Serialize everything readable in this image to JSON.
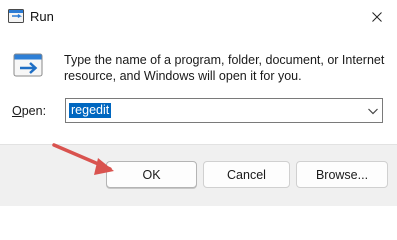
{
  "window": {
    "title": "Run"
  },
  "body": {
    "description": "Type the name of a program, folder, document, or Internet resource, and Windows will open it for you."
  },
  "open": {
    "label_access_key": "O",
    "label_rest": "pen:",
    "value": "regedit"
  },
  "buttons": {
    "ok": "OK",
    "cancel": "Cancel",
    "browse": "Browse..."
  },
  "colors": {
    "selection": "#0067c0",
    "annotation_arrow": "#d9534f"
  }
}
